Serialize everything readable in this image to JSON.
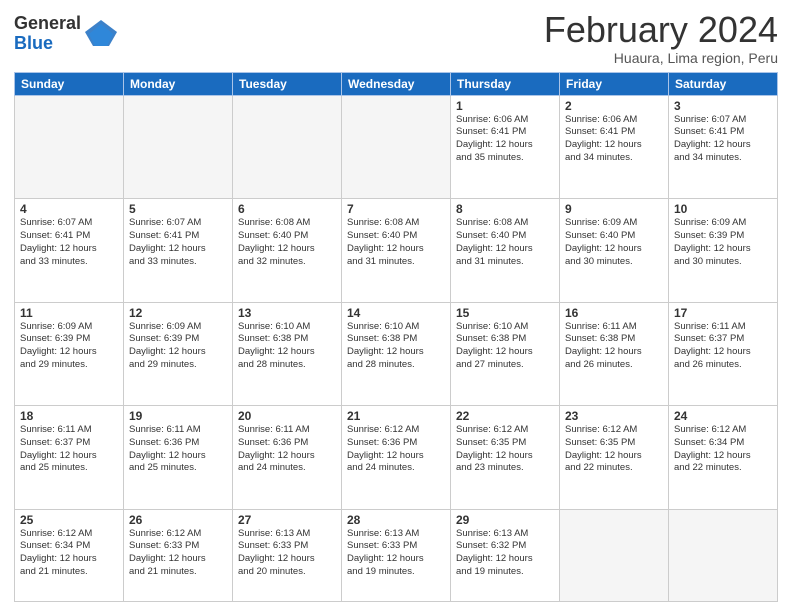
{
  "logo": {
    "general": "General",
    "blue": "Blue"
  },
  "title": "February 2024",
  "subtitle": "Huaura, Lima region, Peru",
  "headers": [
    "Sunday",
    "Monday",
    "Tuesday",
    "Wednesday",
    "Thursday",
    "Friday",
    "Saturday"
  ],
  "weeks": [
    [
      {
        "day": "",
        "info": ""
      },
      {
        "day": "",
        "info": ""
      },
      {
        "day": "",
        "info": ""
      },
      {
        "day": "",
        "info": ""
      },
      {
        "day": "1",
        "info": "Sunrise: 6:06 AM\nSunset: 6:41 PM\nDaylight: 12 hours\nand 35 minutes."
      },
      {
        "day": "2",
        "info": "Sunrise: 6:06 AM\nSunset: 6:41 PM\nDaylight: 12 hours\nand 34 minutes."
      },
      {
        "day": "3",
        "info": "Sunrise: 6:07 AM\nSunset: 6:41 PM\nDaylight: 12 hours\nand 34 minutes."
      }
    ],
    [
      {
        "day": "4",
        "info": "Sunrise: 6:07 AM\nSunset: 6:41 PM\nDaylight: 12 hours\nand 33 minutes."
      },
      {
        "day": "5",
        "info": "Sunrise: 6:07 AM\nSunset: 6:41 PM\nDaylight: 12 hours\nand 33 minutes."
      },
      {
        "day": "6",
        "info": "Sunrise: 6:08 AM\nSunset: 6:40 PM\nDaylight: 12 hours\nand 32 minutes."
      },
      {
        "day": "7",
        "info": "Sunrise: 6:08 AM\nSunset: 6:40 PM\nDaylight: 12 hours\nand 31 minutes."
      },
      {
        "day": "8",
        "info": "Sunrise: 6:08 AM\nSunset: 6:40 PM\nDaylight: 12 hours\nand 31 minutes."
      },
      {
        "day": "9",
        "info": "Sunrise: 6:09 AM\nSunset: 6:40 PM\nDaylight: 12 hours\nand 30 minutes."
      },
      {
        "day": "10",
        "info": "Sunrise: 6:09 AM\nSunset: 6:39 PM\nDaylight: 12 hours\nand 30 minutes."
      }
    ],
    [
      {
        "day": "11",
        "info": "Sunrise: 6:09 AM\nSunset: 6:39 PM\nDaylight: 12 hours\nand 29 minutes."
      },
      {
        "day": "12",
        "info": "Sunrise: 6:09 AM\nSunset: 6:39 PM\nDaylight: 12 hours\nand 29 minutes."
      },
      {
        "day": "13",
        "info": "Sunrise: 6:10 AM\nSunset: 6:38 PM\nDaylight: 12 hours\nand 28 minutes."
      },
      {
        "day": "14",
        "info": "Sunrise: 6:10 AM\nSunset: 6:38 PM\nDaylight: 12 hours\nand 28 minutes."
      },
      {
        "day": "15",
        "info": "Sunrise: 6:10 AM\nSunset: 6:38 PM\nDaylight: 12 hours\nand 27 minutes."
      },
      {
        "day": "16",
        "info": "Sunrise: 6:11 AM\nSunset: 6:38 PM\nDaylight: 12 hours\nand 26 minutes."
      },
      {
        "day": "17",
        "info": "Sunrise: 6:11 AM\nSunset: 6:37 PM\nDaylight: 12 hours\nand 26 minutes."
      }
    ],
    [
      {
        "day": "18",
        "info": "Sunrise: 6:11 AM\nSunset: 6:37 PM\nDaylight: 12 hours\nand 25 minutes."
      },
      {
        "day": "19",
        "info": "Sunrise: 6:11 AM\nSunset: 6:36 PM\nDaylight: 12 hours\nand 25 minutes."
      },
      {
        "day": "20",
        "info": "Sunrise: 6:11 AM\nSunset: 6:36 PM\nDaylight: 12 hours\nand 24 minutes."
      },
      {
        "day": "21",
        "info": "Sunrise: 6:12 AM\nSunset: 6:36 PM\nDaylight: 12 hours\nand 24 minutes."
      },
      {
        "day": "22",
        "info": "Sunrise: 6:12 AM\nSunset: 6:35 PM\nDaylight: 12 hours\nand 23 minutes."
      },
      {
        "day": "23",
        "info": "Sunrise: 6:12 AM\nSunset: 6:35 PM\nDaylight: 12 hours\nand 22 minutes."
      },
      {
        "day": "24",
        "info": "Sunrise: 6:12 AM\nSunset: 6:34 PM\nDaylight: 12 hours\nand 22 minutes."
      }
    ],
    [
      {
        "day": "25",
        "info": "Sunrise: 6:12 AM\nSunset: 6:34 PM\nDaylight: 12 hours\nand 21 minutes."
      },
      {
        "day": "26",
        "info": "Sunrise: 6:12 AM\nSunset: 6:33 PM\nDaylight: 12 hours\nand 21 minutes."
      },
      {
        "day": "27",
        "info": "Sunrise: 6:13 AM\nSunset: 6:33 PM\nDaylight: 12 hours\nand 20 minutes."
      },
      {
        "day": "28",
        "info": "Sunrise: 6:13 AM\nSunset: 6:33 PM\nDaylight: 12 hours\nand 19 minutes."
      },
      {
        "day": "29",
        "info": "Sunrise: 6:13 AM\nSunset: 6:32 PM\nDaylight: 12 hours\nand 19 minutes."
      },
      {
        "day": "",
        "info": ""
      },
      {
        "day": "",
        "info": ""
      }
    ]
  ]
}
